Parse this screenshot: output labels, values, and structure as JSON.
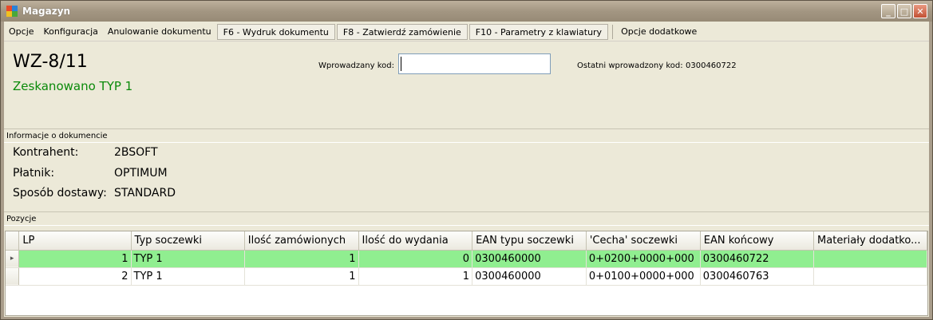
{
  "window": {
    "title": "Magazyn"
  },
  "menu": [
    "Opcje",
    "Konfiguracja",
    "Anulowanie dokumentu",
    "F6 - Wydruk dokumentu",
    "F8 - Zatwierdź zamówienie",
    "F10 - Parametry z klawiatury",
    "Opcje dodatkowe"
  ],
  "document": {
    "number": "WZ-8/11",
    "status": "Zeskanowano TYP 1",
    "status_color": "#0a8a0a"
  },
  "code_entry": {
    "label": "Wprowadzany kod:",
    "value": ""
  },
  "last_code": {
    "label": "Ostatni wprowadzony kod:",
    "value": "0300460722"
  },
  "info": {
    "header": "Informacje o dokumencie",
    "contractor_label": "Kontrahent:",
    "contractor": "2BSOFT",
    "payer_label": "Płatnik:",
    "payer": "OPTIMUM",
    "delivery_label": "Sposób dostawy:",
    "delivery": "STANDARD"
  },
  "positions": {
    "header": "Pozycje",
    "columns": [
      "LP",
      "Typ soczewki",
      "Ilość zamówionych",
      "Ilość do wydania",
      "EAN typu soczewki",
      "'Cecha' soczewki",
      "EAN końcowy",
      "Materiały dodatko..."
    ],
    "rows": [
      {
        "lp": "1",
        "type": "TYP 1",
        "ordered": "1",
        "to_issue": "0",
        "ean_type": "0300460000",
        "feature": "0+0200+0000+000",
        "ean_final": "0300460722",
        "materials": ""
      },
      {
        "lp": "2",
        "type": "TYP 1",
        "ordered": "1",
        "to_issue": "1",
        "ean_type": "0300460000",
        "feature": "0+0100+0000+000",
        "ean_final": "0300460763",
        "materials": ""
      }
    ],
    "selected_color": "#90ee90"
  }
}
